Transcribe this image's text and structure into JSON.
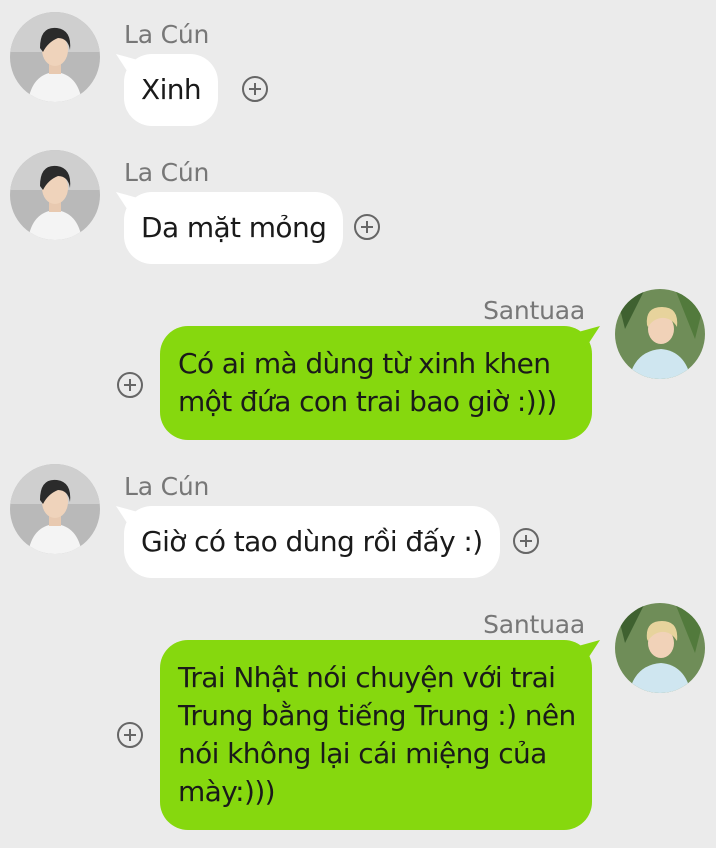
{
  "messages": [
    {
      "sender": "La Cún",
      "text": "Xinh",
      "direction": "received"
    },
    {
      "sender": "La Cún",
      "text": "Da mặt mỏng",
      "direction": "received"
    },
    {
      "sender": "Santuaa",
      "lines": [
        "Có ai mà dùng từ xinh khen",
        "một đứa con trai bao giờ :)))"
      ],
      "direction": "sent"
    },
    {
      "sender": "La Cún",
      "text": "Giờ có tao dùng rồi đấy :)",
      "direction": "received"
    },
    {
      "sender": "Santuaa",
      "lines": [
        "Trai Nhật nói chuyện với trai",
        "Trung bằng tiếng Trung :) nên",
        "nói không lại cái miệng của",
        "mày:)))"
      ],
      "direction": "sent"
    }
  ],
  "icons": {
    "react": "add-reaction-icon",
    "avatar_received": "profile-photo",
    "avatar_sent": "profile-photo"
  },
  "colors": {
    "background": "#ebebeb",
    "sent_bubble": "#86d80e",
    "received_bubble": "#ffffff",
    "sender_name": "#777777"
  }
}
